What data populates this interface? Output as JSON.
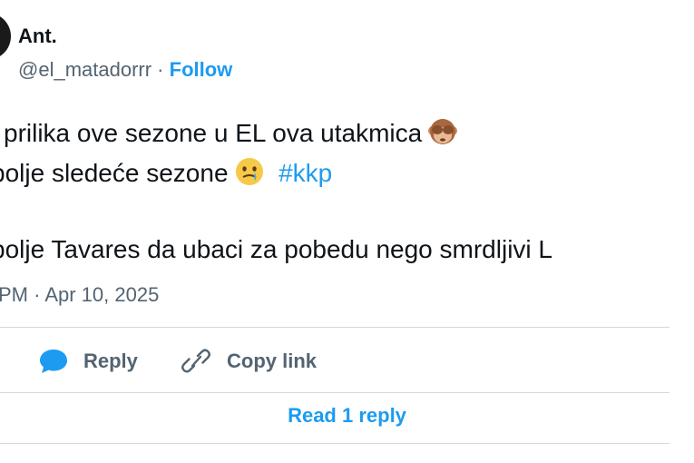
{
  "author": {
    "name": "Ant.",
    "handle": "@el_matadorrr",
    "separator": " · ",
    "follow_label": "Follow"
  },
  "tweet": {
    "line1": "i prilika ove sezone u EL ova utakmica",
    "line1_emoji": "see-no-evil-monkey-icon",
    "line2": "bolje sledeće sezone",
    "line2_emoji": "face-holding-back-tears-icon",
    "hashtag": "#kkp",
    "line3": "bolje Tavares da ubaci za pobedu nego smrdljivi L",
    "timestamp": "PM · Apr 10, 2025"
  },
  "actions": {
    "reply_label": "Reply",
    "reply_icon": "speech-bubble-icon",
    "copy_label": "Copy link",
    "copy_icon": "link-icon"
  },
  "footer": {
    "read_reply_label": "Read 1 reply"
  },
  "colors": {
    "accent": "#1d9bf0",
    "text": "#0f1419",
    "muted": "#536471",
    "divider": "#cfd9de"
  }
}
